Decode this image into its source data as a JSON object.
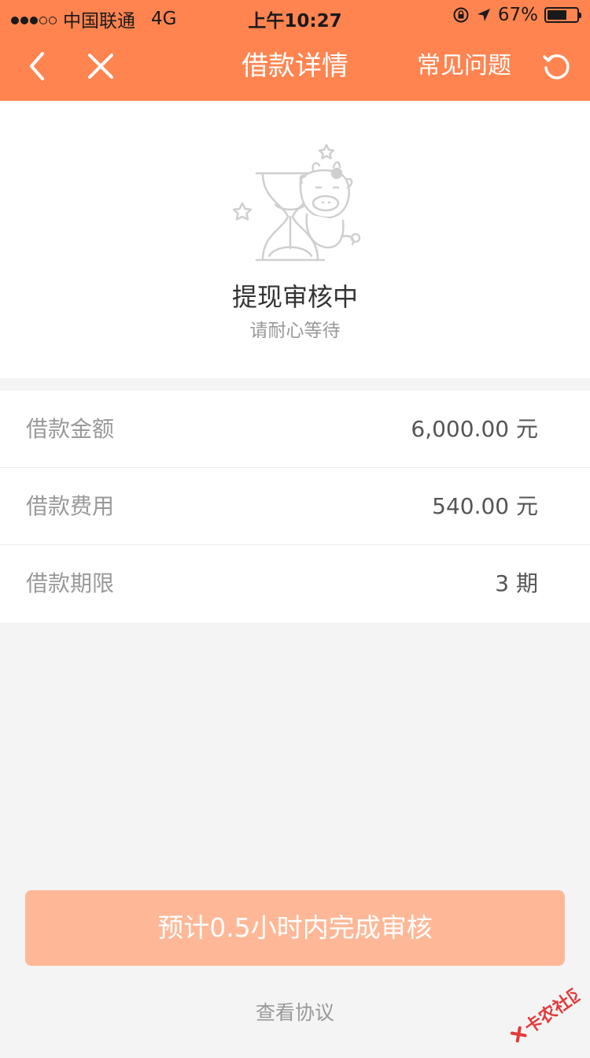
{
  "status_bar": {
    "carrier": "中国联通",
    "network": "4G",
    "time": "上午10:27",
    "battery": "67%",
    "battery_level": 0.67
  },
  "nav": {
    "title": "借款详情",
    "faq_label": "常见问题",
    "back_icon": "chevron-left-icon",
    "close_icon": "close-icon",
    "refresh_icon": "refresh-icon"
  },
  "status": {
    "title": "提现审核中",
    "subtitle": "请耐心等待"
  },
  "details": [
    {
      "label": "借款金额",
      "value": "6,000.00 元"
    },
    {
      "label": "借款费用",
      "value": "540.00 元"
    },
    {
      "label": "借款期限",
      "value": "3 期"
    }
  ],
  "cta_label": "预计0.5小时内完成审核",
  "agreement_label": "查看协议",
  "watermark_text": "卡农社区",
  "colors": {
    "brand": "#ff8450",
    "button": "#ffb897",
    "background": "#f4f4f4"
  }
}
